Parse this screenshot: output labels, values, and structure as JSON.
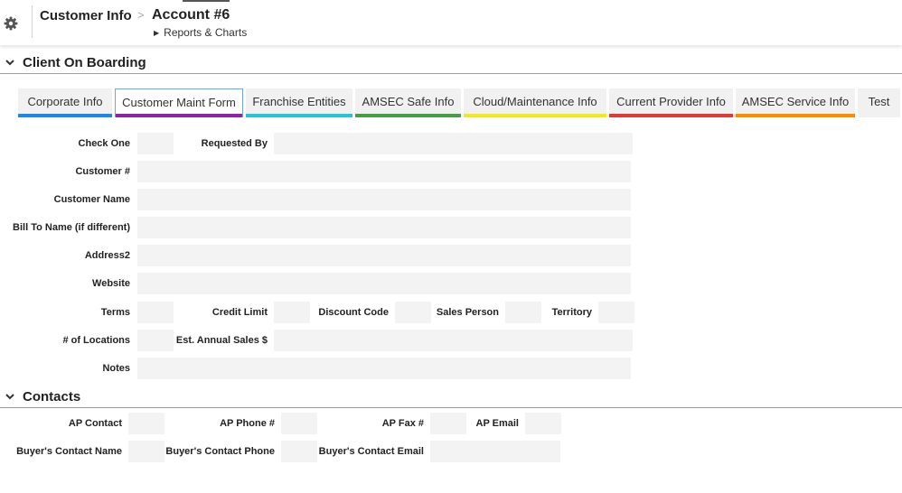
{
  "header": {
    "breadcrumb_root": "Customer Info",
    "breadcrumb_separator": ">",
    "breadcrumb_current": "Account #6",
    "reports_link": "Reports & Charts"
  },
  "sections": {
    "onboarding_title": "Client On Boarding",
    "contacts_title": "Contacts"
  },
  "tabs": [
    {
      "label": "Corporate Info",
      "color": "#1e88e5"
    },
    {
      "label": "Customer Maint Form",
      "color": "#8e24aa",
      "active": true
    },
    {
      "label": "Franchise Entities",
      "color": "#26c6da"
    },
    {
      "label": "AMSEC Safe Info",
      "color": "#43a047"
    },
    {
      "label": "Cloud/Maintenance Info",
      "color": "#f4e91c"
    },
    {
      "label": "Current Provider Info",
      "color": "#e53935"
    },
    {
      "label": "AMSEC Service Info",
      "color": "#fb8c00"
    },
    {
      "label": "Test",
      "color": ""
    }
  ],
  "form": {
    "check_one": {
      "label": "Check One",
      "value": ""
    },
    "requested_by": {
      "label": "Requested By",
      "value": ""
    },
    "customer_number": {
      "label": "Customer #",
      "value": ""
    },
    "customer_name": {
      "label": "Customer Name",
      "value": ""
    },
    "bill_to_name": {
      "label": "Bill To Name (if different)",
      "value": ""
    },
    "address2": {
      "label": "Address2",
      "value": ""
    },
    "website": {
      "label": "Website",
      "value": ""
    },
    "terms": {
      "label": "Terms",
      "value": ""
    },
    "credit_limit": {
      "label": "Credit Limit",
      "value": ""
    },
    "discount_code": {
      "label": "Discount Code",
      "value": ""
    },
    "sales_person": {
      "label": "Sales Person",
      "value": ""
    },
    "territory": {
      "label": "Territory",
      "value": ""
    },
    "num_locations": {
      "label": "# of Locations",
      "value": ""
    },
    "est_annual_sales": {
      "label": "Est. Annual Sales $",
      "value": ""
    },
    "notes": {
      "label": "Notes",
      "value": ""
    }
  },
  "contacts": {
    "ap_contact": {
      "label": "AP Contact",
      "value": ""
    },
    "ap_phone": {
      "label": "AP Phone #",
      "value": ""
    },
    "ap_fax": {
      "label": "AP Fax #",
      "value": ""
    },
    "ap_email": {
      "label": "AP Email",
      "value": ""
    },
    "buyer_contact_name": {
      "label": "Buyer's Contact Name",
      "value": ""
    },
    "buyer_contact_phone": {
      "label": "Buyer's Contact Phone",
      "value": ""
    },
    "buyer_contact_email": {
      "label": "Buyer's Contact Email",
      "value": ""
    }
  },
  "icons": {
    "settings": "gear-icon",
    "collapse": "chevron-down-icon",
    "expand_link": "triangle-right-icon"
  }
}
